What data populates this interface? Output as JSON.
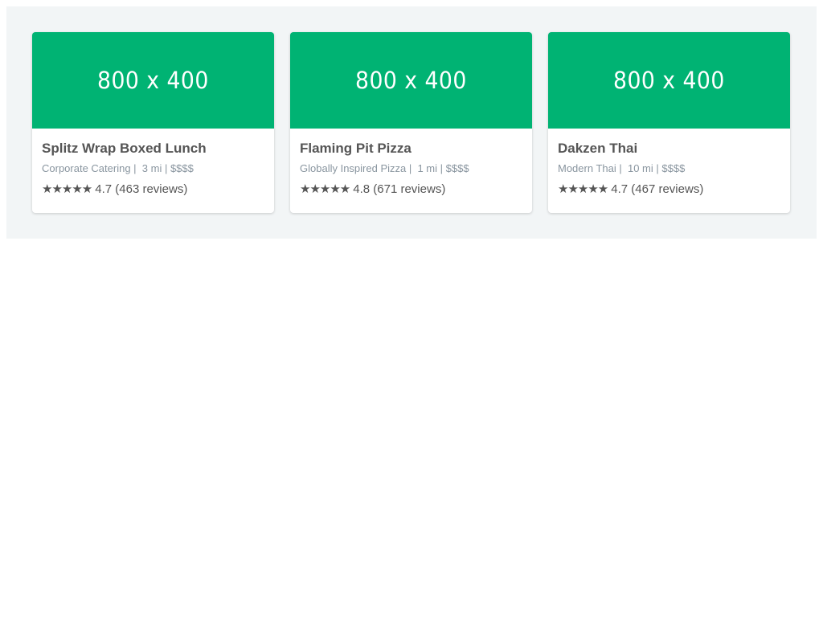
{
  "colors": {
    "panel_background": "#f2f5f6",
    "image_placeholder": "#00b373",
    "title_text": "#555555",
    "meta_text": "#8a96a0"
  },
  "restaurants": [
    {
      "image_text": "800 x 400",
      "name": "Splitz Wrap Boxed Lunch",
      "cuisine": "Corporate Catering",
      "distance": "3 mi",
      "price": "$$$$",
      "stars": "★★★★★",
      "rating": "4.7",
      "reviews": "(463 reviews)"
    },
    {
      "image_text": "800 x 400",
      "name": "Flaming Pit Pizza",
      "cuisine": "Globally Inspired Pizza",
      "distance": "1 mi",
      "price": "$$$$",
      "stars": "★★★★★",
      "rating": "4.8",
      "reviews": "(671 reviews)"
    },
    {
      "image_text": "800 x 400",
      "name": "Dakzen Thai",
      "cuisine": "Modern Thai",
      "distance": "10 mi",
      "price": "$$$$",
      "stars": "★★★★★",
      "rating": "4.7",
      "reviews": "(467 reviews)"
    }
  ]
}
